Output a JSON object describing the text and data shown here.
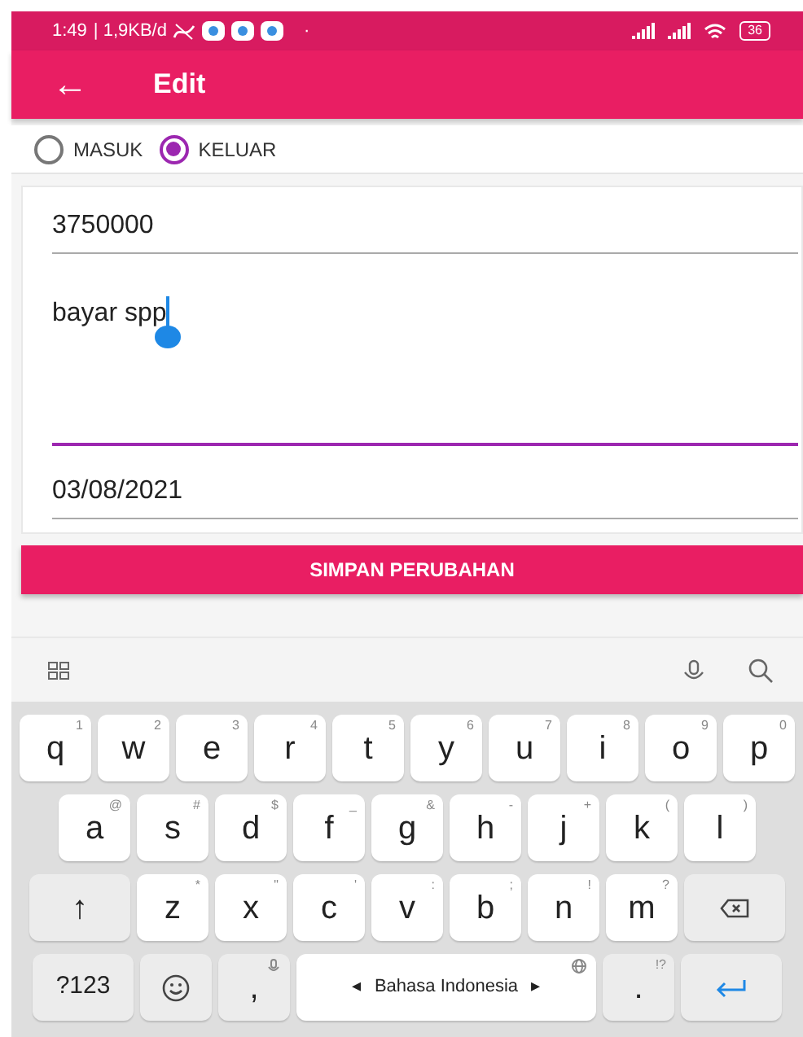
{
  "status_bar": {
    "time": "1:49",
    "data_rate": "| 1,9KB/d",
    "dot": "·",
    "battery": "36"
  },
  "app_bar": {
    "back": "←",
    "title": "Edit"
  },
  "type_options": [
    {
      "label": "MASUK",
      "selected": false
    },
    {
      "label": "KELUAR",
      "selected": true
    }
  ],
  "form": {
    "fields": [
      {
        "kind": "line",
        "value": "3750000",
        "focused": false
      },
      {
        "kind": "area",
        "value": "bayar spp",
        "focused": true
      },
      {
        "kind": "line",
        "value": "03/08/2021",
        "focused": false
      }
    ]
  },
  "save_button": "SIMPAN PERUBAHAN",
  "keyboard": {
    "letter_rows": [
      {
        "keys": [
          {
            "kind": "char",
            "label": "q",
            "hint": "1"
          },
          {
            "kind": "char",
            "label": "w",
            "hint": "2"
          },
          {
            "kind": "char",
            "label": "e",
            "hint": "3"
          },
          {
            "kind": "char",
            "label": "r",
            "hint": "4"
          },
          {
            "kind": "char",
            "label": "t",
            "hint": "5"
          },
          {
            "kind": "char",
            "label": "y",
            "hint": "6"
          },
          {
            "kind": "char",
            "label": "u",
            "hint": "7"
          },
          {
            "kind": "char",
            "label": "i",
            "hint": "8"
          },
          {
            "kind": "char",
            "label": "o",
            "hint": "9"
          },
          {
            "kind": "char",
            "label": "p",
            "hint": "0"
          }
        ]
      },
      {
        "keys": [
          {
            "kind": "char",
            "label": "a",
            "hint": "@"
          },
          {
            "kind": "char",
            "label": "s",
            "hint": "#"
          },
          {
            "kind": "char",
            "label": "d",
            "hint": "$"
          },
          {
            "kind": "char",
            "label": "f",
            "hint": "_"
          },
          {
            "kind": "char",
            "label": "g",
            "hint": "&"
          },
          {
            "kind": "char",
            "label": "h",
            "hint": "-"
          },
          {
            "kind": "char",
            "label": "j",
            "hint": "+"
          },
          {
            "kind": "char",
            "label": "k",
            "hint": "("
          },
          {
            "kind": "char",
            "label": "l",
            "hint": ")"
          }
        ]
      },
      {
        "keys": [
          {
            "kind": "shift",
            "label": "↑"
          },
          {
            "kind": "char",
            "label": "z",
            "hint": "*"
          },
          {
            "kind": "char",
            "label": "x",
            "hint": "\""
          },
          {
            "kind": "char",
            "label": "c",
            "hint": "'"
          },
          {
            "kind": "char",
            "label": "v",
            "hint": ":"
          },
          {
            "kind": "char",
            "label": "b",
            "hint": ";"
          },
          {
            "kind": "char",
            "label": "n",
            "hint": "!"
          },
          {
            "kind": "char",
            "label": "m",
            "hint": "?"
          },
          {
            "kind": "backspace"
          }
        ]
      }
    ],
    "bottom_row": {
      "symbols_key": "?123",
      "comma_key": ",",
      "space_bar": {
        "label": "Bahasa Indonesia",
        "left": "◂",
        "right": "▸"
      },
      "period_key": {
        "label": ".",
        "hint": "!?"
      }
    }
  }
}
